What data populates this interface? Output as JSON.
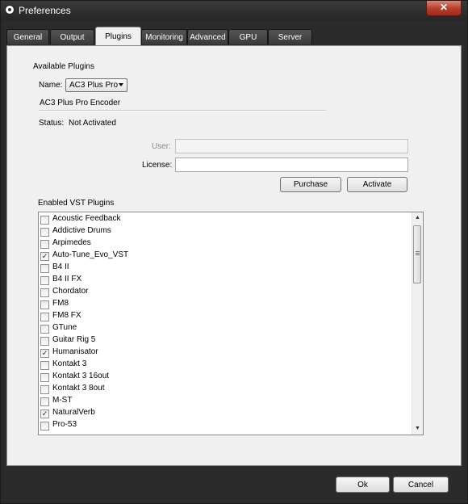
{
  "window": {
    "title": "Preferences",
    "close_label": "✕"
  },
  "tabs": [
    {
      "label": "General"
    },
    {
      "label": "Output"
    },
    {
      "label": "Plugins"
    },
    {
      "label": "Monitoring"
    },
    {
      "label": "Advanced"
    },
    {
      "label": "GPU"
    },
    {
      "label": "Server"
    }
  ],
  "active_tab": "Plugins",
  "plugins": {
    "section_title": "Available Plugins",
    "name_label": "Name:",
    "name_value": "AC3 Plus Pro",
    "description": "AC3 Plus Pro Encoder",
    "status_label": "Status:",
    "status_value": "Not Activated",
    "user_label": "User:",
    "user_value": "",
    "license_label": "License:",
    "license_value": "",
    "purchase_label": "Purchase",
    "activate_label": "Activate"
  },
  "vst": {
    "title": "Enabled VST Plugins",
    "items": [
      {
        "label": "Acoustic Feedback",
        "checked": false
      },
      {
        "label": "Addictive Drums",
        "checked": false
      },
      {
        "label": "Arpimedes",
        "checked": false
      },
      {
        "label": "Auto-Tune_Evo_VST",
        "checked": true
      },
      {
        "label": "B4 II",
        "checked": false
      },
      {
        "label": "B4 II FX",
        "checked": false
      },
      {
        "label": "Chordator",
        "checked": false
      },
      {
        "label": "FM8",
        "checked": false
      },
      {
        "label": "FM8 FX",
        "checked": false
      },
      {
        "label": "GTune",
        "checked": false
      },
      {
        "label": "Guitar Rig 5",
        "checked": false
      },
      {
        "label": "Humanisator",
        "checked": true
      },
      {
        "label": "Kontakt 3",
        "checked": false
      },
      {
        "label": "Kontakt 3 16out",
        "checked": false
      },
      {
        "label": "Kontakt 3 8out",
        "checked": false
      },
      {
        "label": "M-ST",
        "checked": false
      },
      {
        "label": "NaturalVerb",
        "checked": true
      },
      {
        "label": "Pro-53",
        "checked": false
      }
    ]
  },
  "footer": {
    "ok_label": "Ok",
    "cancel_label": "Cancel"
  },
  "icons": {
    "check_glyph": "✓",
    "scroll_up": "▲",
    "scroll_down": "▼"
  }
}
